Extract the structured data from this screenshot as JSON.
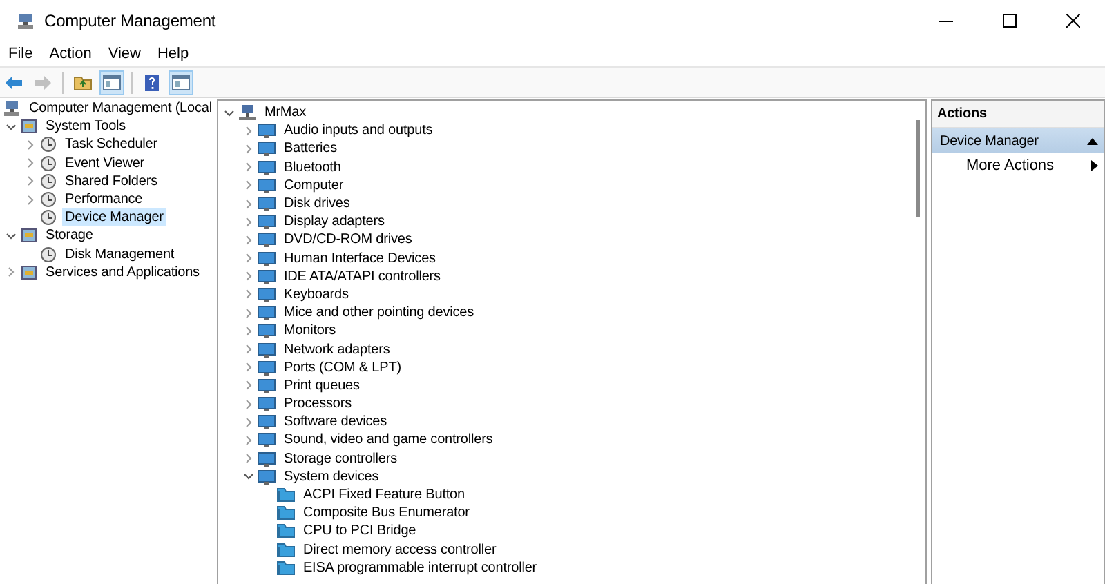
{
  "window": {
    "title": "Computer Management"
  },
  "menu": [
    "File",
    "Action",
    "View",
    "Help"
  ],
  "toolbar": [
    {
      "kind": "back",
      "disabled": false,
      "on": false
    },
    {
      "kind": "forward",
      "disabled": true,
      "on": false
    },
    {
      "kind": "folder",
      "disabled": false,
      "on": false
    },
    {
      "kind": "pane",
      "disabled": false,
      "on": true
    },
    {
      "kind": "help",
      "disabled": false,
      "on": false
    },
    {
      "kind": "pane",
      "disabled": false,
      "on": true
    }
  ],
  "console_tree": [
    {
      "label": "Computer Management (Local",
      "selected": false,
      "children": [
        {
          "label": "System Tools",
          "expanded": true,
          "selected": false,
          "children": [
            {
              "label": "Task Scheduler",
              "expanded": false,
              "selected": false
            },
            {
              "label": "Event Viewer",
              "expanded": false,
              "selected": false
            },
            {
              "label": "Shared Folders",
              "expanded": false,
              "selected": false
            },
            {
              "label": "Performance",
              "expanded": false,
              "selected": false
            },
            {
              "label": "Device Manager",
              "selected": true
            }
          ]
        },
        {
          "label": "Storage",
          "expanded": true,
          "selected": false,
          "children": [
            {
              "label": "Disk Management",
              "selected": false
            }
          ]
        },
        {
          "label": "Services and Applications",
          "expanded": false,
          "selected": false
        }
      ]
    }
  ],
  "device_tree": [
    {
      "label": "MrMax",
      "expanded": true,
      "selected": false,
      "children": [
        {
          "label": "Audio inputs and outputs",
          "expanded": false,
          "selected": false
        },
        {
          "label": "Batteries",
          "expanded": false,
          "selected": false
        },
        {
          "label": "Bluetooth",
          "expanded": false,
          "selected": false
        },
        {
          "label": "Computer",
          "expanded": false,
          "selected": false
        },
        {
          "label": "Disk drives",
          "expanded": false,
          "selected": false
        },
        {
          "label": "Display adapters",
          "expanded": false,
          "selected": false
        },
        {
          "label": "DVD/CD-ROM drives",
          "expanded": false,
          "selected": false
        },
        {
          "label": "Human Interface Devices",
          "expanded": false,
          "selected": false
        },
        {
          "label": "IDE ATA/ATAPI controllers",
          "expanded": false,
          "selected": false
        },
        {
          "label": "Keyboards",
          "expanded": false,
          "selected": false
        },
        {
          "label": "Mice and other pointing devices",
          "expanded": false,
          "selected": false
        },
        {
          "label": "Monitors",
          "expanded": false,
          "selected": false
        },
        {
          "label": "Network adapters",
          "expanded": false,
          "selected": false
        },
        {
          "label": "Ports (COM & LPT)",
          "expanded": false,
          "selected": false
        },
        {
          "label": "Print queues",
          "expanded": false,
          "selected": false
        },
        {
          "label": "Processors",
          "expanded": false,
          "selected": false
        },
        {
          "label": "Software devices",
          "expanded": false,
          "selected": false
        },
        {
          "label": "Sound, video and game controllers",
          "expanded": false,
          "selected": false
        },
        {
          "label": "Storage controllers",
          "expanded": false,
          "selected": false
        },
        {
          "label": "System devices",
          "expanded": true,
          "selected": false,
          "children": [
            {
              "label": "ACPI Fixed Feature Button",
              "selected": false
            },
            {
              "label": "Composite Bus Enumerator",
              "selected": false
            },
            {
              "label": "CPU to PCI Bridge",
              "selected": false
            },
            {
              "label": "Direct memory access controller",
              "selected": false
            },
            {
              "label": "EISA programmable interrupt controller",
              "selected": false
            }
          ]
        }
      ]
    }
  ],
  "actions": {
    "title": "Actions",
    "sections": [
      {
        "label": "Device Manager",
        "expanded": true,
        "items": [
          {
            "label": "More Actions",
            "has_submenu": true
          }
        ]
      }
    ]
  }
}
